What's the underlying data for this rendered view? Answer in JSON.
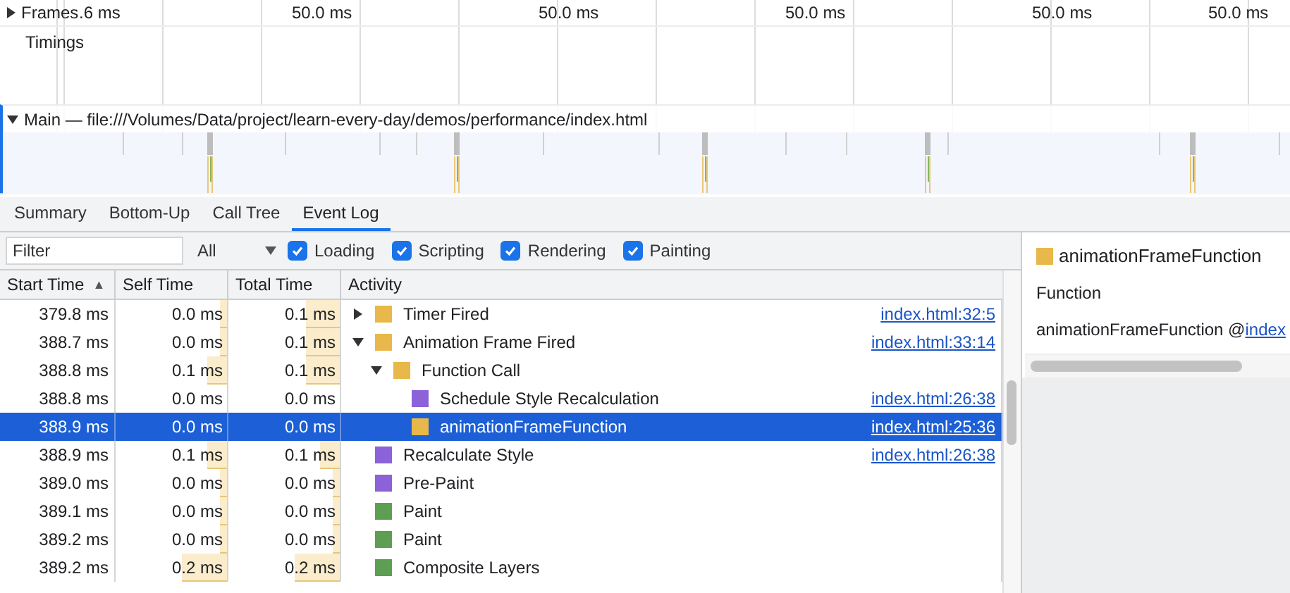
{
  "timeline": {
    "frames": {
      "label": "Frames",
      "expanded": false
    },
    "ticks": [
      ".6 ms",
      "50.0 ms",
      "50.0 ms",
      "50.0 ms",
      "50.0 ms",
      "50.0 ms"
    ],
    "timings": {
      "label": "Timings"
    },
    "main": {
      "label": "Main — file:///Volumes/Data/project/learn-every-day/demos/performance/index.html",
      "expanded": true
    }
  },
  "tabs": [
    {
      "label": "Summary",
      "selected": false
    },
    {
      "label": "Bottom-Up",
      "selected": false
    },
    {
      "label": "Call Tree",
      "selected": false
    },
    {
      "label": "Event Log",
      "selected": true
    }
  ],
  "toolbar": {
    "filter": {
      "placeholder": "Filter"
    },
    "dropdown": {
      "value": "All"
    },
    "checkboxes": [
      {
        "label": "Loading",
        "checked": true
      },
      {
        "label": "Scripting",
        "checked": true
      },
      {
        "label": "Rendering",
        "checked": true
      },
      {
        "label": "Painting",
        "checked": true
      }
    ]
  },
  "table": {
    "columns": [
      {
        "label": "Start Time",
        "sort_indicator": "▲"
      },
      {
        "label": "Self Time"
      },
      {
        "label": "Total Time"
      },
      {
        "label": "Activity"
      }
    ],
    "rows": [
      {
        "start": "379.8 ms",
        "self": "0.0 ms",
        "self_bar": {
          "level": 0.06
        },
        "total": "0.1 ms",
        "total_bar": {
          "level": 0.3
        },
        "activity": "Timer Fired",
        "color": "#e8b84a",
        "link": "index.html:32:5",
        "selected": false,
        "expanded": false
      },
      {
        "start": "388.7 ms",
        "self": "0.0 ms",
        "self_bar": {
          "level": 0.06
        },
        "total": "0.1 ms",
        "total_bar": {
          "level": 0.3
        },
        "activity": "Animation Frame Fired",
        "color": "#e8b84a",
        "link": "index.html:33:14",
        "selected": false,
        "expanded": true,
        "children": [
          {
            "start": "388.8 ms",
            "self": "0.1 ms",
            "self_bar": {
              "level": 0.18
            },
            "total": "0.1 ms",
            "total_bar": {
              "level": 0.3
            },
            "activity": "Function Call",
            "color": "#e8b84a",
            "selected": false,
            "expanded": true,
            "children": [
              {
                "start": "388.8 ms",
                "self": "0.0 ms",
                "total": "0.0 ms",
                "activity": "Schedule Style Recalculation",
                "color": "#8c62d9",
                "link": "index.html:26:38",
                "selected": false
              },
              {
                "start": "388.9 ms",
                "self": "0.0 ms",
                "total": "0.0 ms",
                "activity": "animationFrameFunction",
                "color": "#e8b84a",
                "link": "index.html:25:36",
                "selected": true
              }
            ]
          }
        ]
      },
      {
        "start": "388.9 ms",
        "self": "0.1 ms",
        "self_bar": {
          "level": 0.18
        },
        "total": "0.1 ms",
        "total_bar": {
          "level": 0.18
        },
        "activity": "Recalculate Style",
        "color": "#8c62d9",
        "link": "index.html:26:38",
        "selected": false
      },
      {
        "start": "389.0 ms",
        "self": "0.0 ms",
        "self_bar": {
          "level": 0.06
        },
        "total": "0.0 ms",
        "total_bar": {
          "level": 0.06
        },
        "activity": "Pre-Paint",
        "color": "#8c62d9",
        "selected": false
      },
      {
        "start": "389.1 ms",
        "self": "0.0 ms",
        "self_bar": {
          "level": 0.06
        },
        "total": "0.0 ms",
        "total_bar": {
          "level": 0.06
        },
        "activity": "Paint",
        "color": "#5e9e52",
        "selected": false
      },
      {
        "start": "389.2 ms",
        "self": "0.0 ms",
        "self_bar": {
          "level": 0.06
        },
        "total": "0.0 ms",
        "total_bar": {
          "level": 0.06
        },
        "activity": "Paint",
        "color": "#5e9e52",
        "selected": false
      },
      {
        "start": "389.2 ms",
        "self": "0.2 ms",
        "self_bar": {
          "level": 0.4
        },
        "total": "0.2 ms",
        "total_bar": {
          "level": 0.4
        },
        "activity": "Composite Layers",
        "color": "#5e9e52",
        "selected": false
      }
    ]
  },
  "details": {
    "title": "animationFrameFunction",
    "color": "#e8b84a",
    "type": "Function",
    "function": "animationFrameFunction @ ",
    "link": "index"
  }
}
